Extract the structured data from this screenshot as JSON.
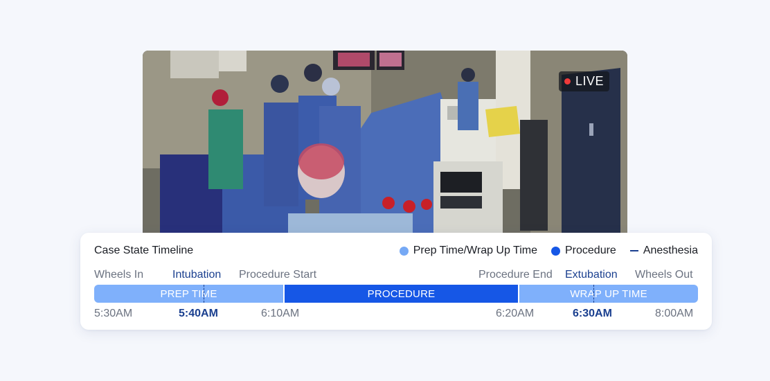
{
  "video": {
    "live_label": "LIVE"
  },
  "timeline": {
    "title": "Case State Timeline",
    "legend": [
      {
        "label": "Prep Time/Wrap Up Time",
        "color": "#76a9f5"
      },
      {
        "label": "Procedure",
        "color": "#1657e6"
      },
      {
        "label": "Anesthesia",
        "color": "#1a3f8f"
      }
    ],
    "events": {
      "wheels_in": "Wheels In",
      "intubation": "Intubation",
      "procedure_start": "Procedure Start",
      "procedure_end": "Procedure End",
      "extubation": "Extubation",
      "wheels_out": "Wheels Out"
    },
    "segments": {
      "prep": "PREP TIME",
      "procedure": "PROCEDURE",
      "wrap_up": "WRAP UP TIME"
    },
    "times": {
      "wheels_in": "5:30AM",
      "intubation": "5:40AM",
      "procedure_start": "6:10AM",
      "procedure_end": "6:20AM",
      "extubation": "6:30AM",
      "wheels_out": "8:00AM"
    }
  }
}
